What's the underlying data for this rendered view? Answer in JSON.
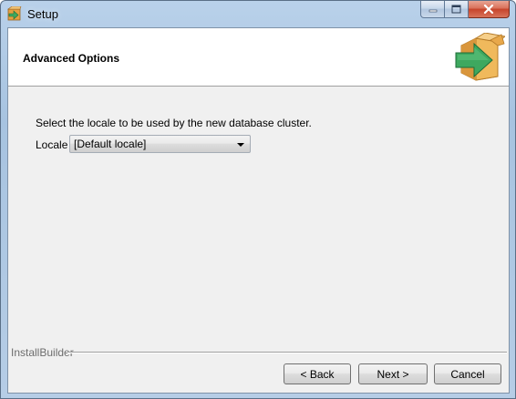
{
  "window": {
    "title": "Setup",
    "icon": "installer-icon",
    "controls": {
      "minimize_icon": "minimize-icon",
      "maximize_icon": "maximize-icon",
      "close_icon": "close-icon"
    }
  },
  "header": {
    "title": "Advanced Options",
    "logo_icon": "box-arrow-icon"
  },
  "main": {
    "prompt": "Select the locale to be used by the new database cluster.",
    "locale_label": "Locale",
    "locale_value": "[Default locale]"
  },
  "footer": {
    "brand": "InstallBuilder",
    "back_label": "< Back",
    "next_label": "Next >",
    "cancel_label": "Cancel"
  },
  "colors": {
    "logo_box": "#e8a84a",
    "logo_arrow": "#3ea85f",
    "close_button": "#c6432a"
  }
}
